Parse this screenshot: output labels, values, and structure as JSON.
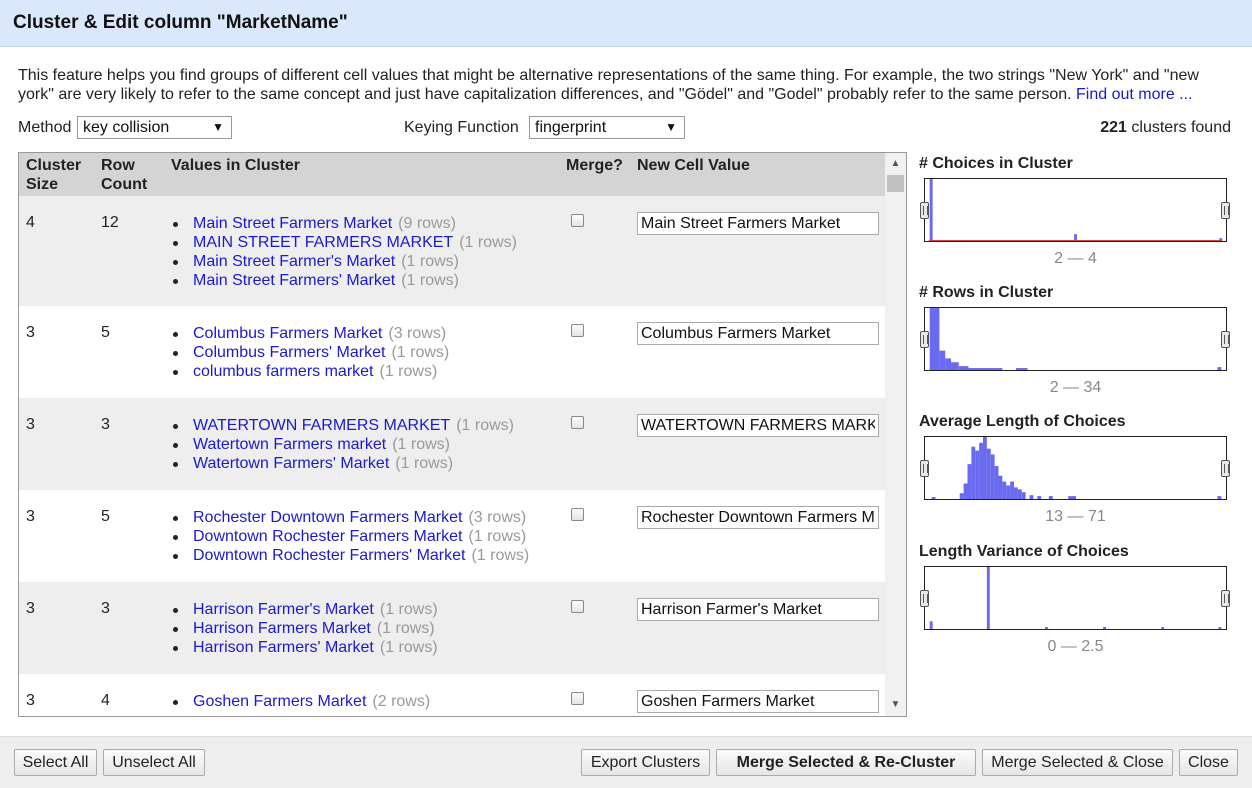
{
  "dialog": {
    "title": "Cluster & Edit column \"MarketName\""
  },
  "description": {
    "text": "This feature helps you find groups of different cell values that might be alternative representations of the same thing. For example, the two strings \"New York\" and \"new york\" are very likely to refer to the same concept and just have capitalization differences, and \"Gödel\" and \"Godel\" probably refer to the same person.",
    "link": "Find out more ..."
  },
  "controls": {
    "method_label": "Method",
    "method_value": "key collision",
    "keying_label": "Keying Function",
    "keying_value": "fingerprint",
    "clusters_count": "221",
    "clusters_suffix": "clusters found"
  },
  "table": {
    "headers": {
      "cluster_size_1": "Cluster",
      "cluster_size_2": "Size",
      "row_count_1": "Row",
      "row_count_2": "Count",
      "values": "Values in Cluster",
      "merge": "Merge?",
      "new_value": "New Cell Value"
    },
    "rows": [
      {
        "size": "4",
        "count": "12",
        "values": [
          {
            "text": "Main Street Farmers Market",
            "rows": "(9 rows)"
          },
          {
            "text": "MAIN STREET FARMERS MARKET",
            "rows": "(1 rows)"
          },
          {
            "text": "Main Street Farmer's Market",
            "rows": "(1 rows)"
          },
          {
            "text": "Main Street Farmers' Market",
            "rows": "(1 rows)"
          }
        ],
        "new_value": "Main Street Farmers Market"
      },
      {
        "size": "3",
        "count": "5",
        "values": [
          {
            "text": "Columbus Farmers Market",
            "rows": "(3 rows)"
          },
          {
            "text": "Columbus Farmers' Market",
            "rows": "(1 rows)"
          },
          {
            "text": "columbus farmers market",
            "rows": "(1 rows)"
          }
        ],
        "new_value": "Columbus Farmers Market"
      },
      {
        "size": "3",
        "count": "3",
        "values": [
          {
            "text": "WATERTOWN FARMERS MARKET",
            "rows": "(1 rows)"
          },
          {
            "text": "Watertown Farmers market",
            "rows": "(1 rows)"
          },
          {
            "text": "Watertown Farmers' Market",
            "rows": "(1 rows)"
          }
        ],
        "new_value": "WATERTOWN FARMERS MARKET"
      },
      {
        "size": "3",
        "count": "5",
        "values": [
          {
            "text": "Rochester Downtown Farmers Market",
            "rows": "(3 rows)"
          },
          {
            "text": "Downtown Rochester Farmers Market",
            "rows": "(1 rows)"
          },
          {
            "text": "Downtown Rochester Farmers' Market",
            "rows": "(1 rows)"
          }
        ],
        "new_value": "Rochester Downtown Farmers Market"
      },
      {
        "size": "3",
        "count": "3",
        "values": [
          {
            "text": "Harrison Farmer's Market",
            "rows": "(1 rows)"
          },
          {
            "text": "Harrison Farmers Market",
            "rows": "(1 rows)"
          },
          {
            "text": "Harrison Farmers' Market",
            "rows": "(1 rows)"
          }
        ],
        "new_value": "Harrison Farmer's Market"
      },
      {
        "size": "3",
        "count": "4",
        "values": [
          {
            "text": "Goshen Farmers Market",
            "rows": "(2 rows)"
          }
        ],
        "new_value": "Goshen Farmers Market"
      }
    ]
  },
  "facets": [
    {
      "title": "# Choices in Cluster",
      "range": "2 — 4"
    },
    {
      "title": "# Rows in Cluster",
      "range": "2 — 34"
    },
    {
      "title": "Average Length of Choices",
      "range": "13 — 71"
    },
    {
      "title": "Length Variance of Choices",
      "range": "0 — 2.5"
    }
  ],
  "buttons": {
    "select_all": "Select All",
    "unselect_all": "Unselect All",
    "export": "Export Clusters",
    "merge_recluster": "Merge Selected & Re-Cluster",
    "merge_close": "Merge Selected & Close",
    "close": "Close"
  },
  "colors": {
    "histogram": "#6a6af0",
    "link": "#1a1acf",
    "title_bar": "#dbe8fb"
  }
}
